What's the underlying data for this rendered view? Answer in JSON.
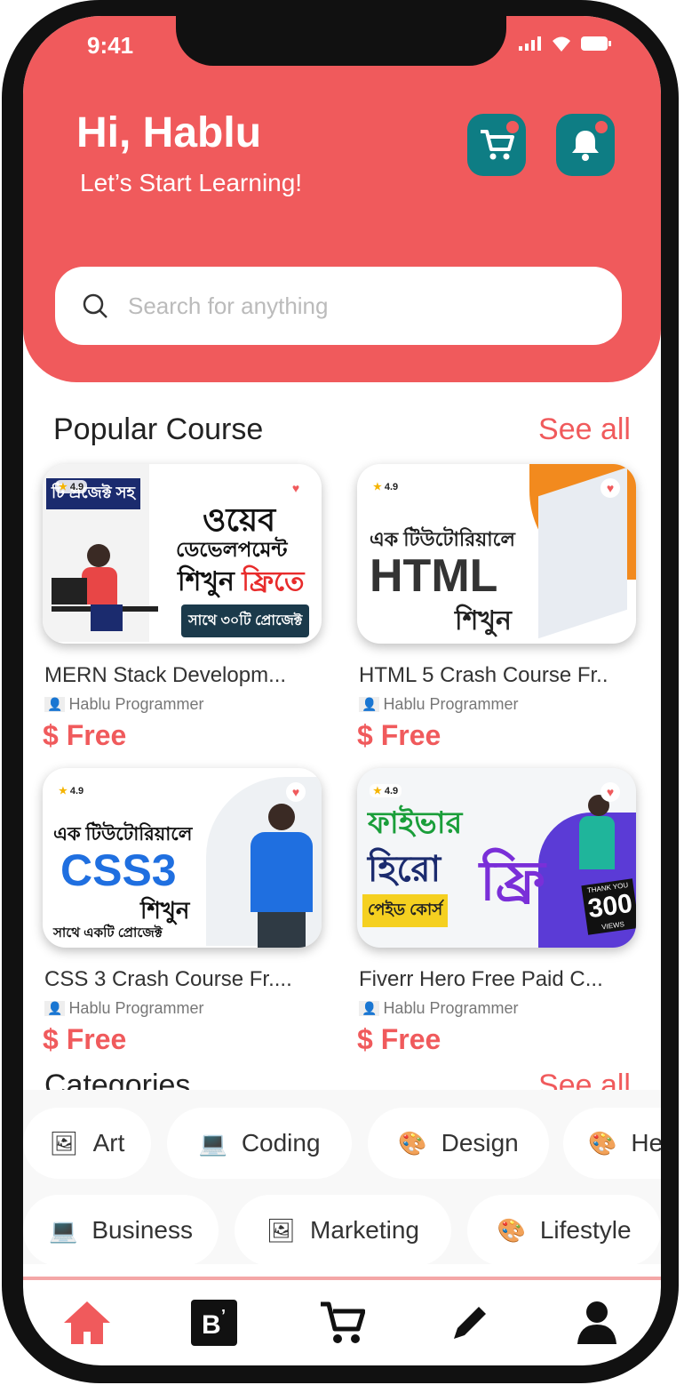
{
  "status": {
    "time": "9:41"
  },
  "header": {
    "greeting": "Hi, Hablu",
    "subtitle": "Let’s Start Learning!",
    "search_placeholder": "Search for anything"
  },
  "popular": {
    "title": "Popular Course",
    "see_all": "See all",
    "courses": [
      {
        "title": "MERN Stack Developm...",
        "author": "Hablu Programmer",
        "price": "$ Free",
        "rating": "4.9",
        "thumb": {
          "line1": "ওয়েব",
          "line2": "ডেভেলপমেন্ট",
          "line3": "শিখুন",
          "accent": "ফ্রিতে",
          "footer": "সাথে ৩০টি প্রোজেক্ট",
          "tag": "টি প্রজেক্ট সহ"
        }
      },
      {
        "title": "HTML 5 Crash Course Fr..",
        "author": "Hablu Programmer",
        "price": "$ Free",
        "rating": "4.9",
        "thumb": {
          "line1": "এক টিউটোরিয়ালে",
          "line2": "HTML",
          "line3": "শিখুন"
        }
      },
      {
        "title": "CSS 3 Crash Course Fr....",
        "author": "Hablu Programmer",
        "price": "$ Free",
        "rating": "4.9",
        "thumb": {
          "line1": "এক টিউটোরিয়ালে",
          "line2": "CSS3",
          "line3": "শিখুন",
          "footer": "সাথে একটি প্রোজেক্ট"
        }
      },
      {
        "title": "Fiverr Hero Free Paid C...",
        "author": "Hablu Programmer",
        "price": "$ Free",
        "rating": "4.9",
        "thumb": {
          "line1": "ফাইভার",
          "line2": "হিরো",
          "line3": "পেইড কোর্স",
          "accent": "ফ্রি",
          "badge": "300",
          "badge_top": "THANK YOU",
          "badge_bottom": "VIEWS"
        }
      }
    ]
  },
  "categories": {
    "title": "Categories",
    "see_all": "See all",
    "row1": [
      {
        "label": "Art",
        "icon": "🖼"
      },
      {
        "label": "Coding",
        "icon": "💻"
      },
      {
        "label": "Design",
        "icon": "🎨"
      },
      {
        "label": "He",
        "icon": "🎨"
      }
    ],
    "row2": [
      {
        "label": "Business",
        "icon": "💻"
      },
      {
        "label": "Marketing",
        "icon": "🖼"
      },
      {
        "label": "Lifestyle",
        "icon": "🎨"
      }
    ]
  },
  "colors": {
    "primary": "#f05a5c",
    "teal": "#0e7d84"
  },
  "nav": [
    "home-icon",
    "blog-icon",
    "cart-icon",
    "pencil-icon",
    "profile-icon"
  ]
}
